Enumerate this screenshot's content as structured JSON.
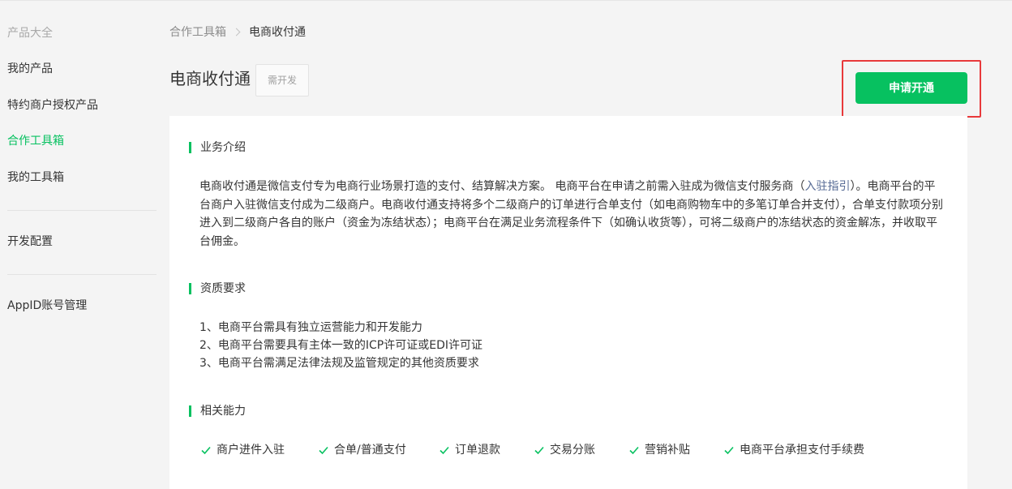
{
  "sidebar": {
    "header": "产品大全",
    "items": [
      {
        "label": "我的产品"
      },
      {
        "label": "特约商户授权产品"
      },
      {
        "label": "合作工具箱"
      },
      {
        "label": "我的工具箱"
      }
    ],
    "dev_config": "开发配置",
    "appid_manage": "AppID账号管理"
  },
  "breadcrumb": {
    "parent": "合作工具箱",
    "current": "电商收付通"
  },
  "page": {
    "title": "电商收付通",
    "tag": "需开发",
    "apply_button": "申请开通"
  },
  "sections": {
    "intro": {
      "title": "业务介绍",
      "text_before_link": "电商收付通是微信支付专为电商行业场景打造的支付、结算解决方案。 电商平台在申请之前需入驻成为微信支付服务商（",
      "link": "入驻指引",
      "text_after_link": "）。电商平台的平台商户入驻微信支付成为二级商户。电商收付通支持将多个二级商户的订单进行合单支付（如电商购物车中的多笔订单合并支付），合单支付款项分别进入到二级商户各自的账户（资金为冻结状态）；电商平台在满足业务流程条件下（如确认收货等），可将二级商户的冻结状态的资金解冻，并收取平台佣金。"
    },
    "requirements": {
      "title": "资质要求",
      "items": [
        "1、电商平台需具有独立运营能力和开发能力",
        "2、电商平台需要具有主体一致的ICP许可证或EDI许可证",
        "3、电商平台需满足法律法规及监管规定的其他资质要求"
      ]
    },
    "capabilities": {
      "title": "相关能力",
      "items": [
        "商户进件入驻",
        "合单/普通支付",
        "订单退款",
        "交易分账",
        "营销补贴",
        "电商平台承担支付手续费"
      ]
    }
  },
  "colors": {
    "accent": "#07c160",
    "highlight": "#e8393b",
    "link": "#576b95"
  }
}
